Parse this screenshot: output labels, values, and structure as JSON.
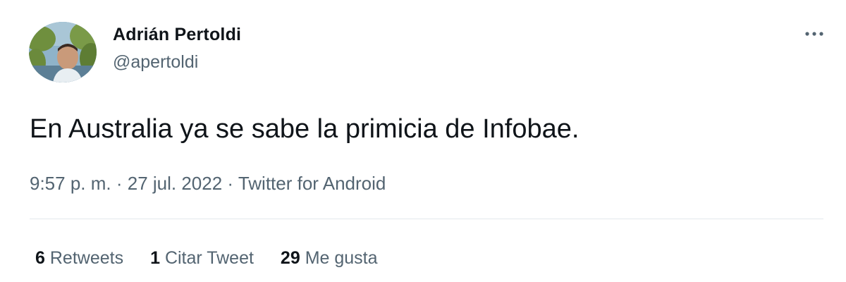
{
  "user": {
    "display_name": "Adrián Pertoldi",
    "handle": "@apertoldi",
    "avatar_icon": "profile-photo"
  },
  "tweet": {
    "text": "En Australia ya se sabe la primicia de Infobae.",
    "time": "9:57 p. m.",
    "sep1": " · ",
    "date": "27 jul. 2022",
    "sep2": " · ",
    "source": "Twitter for Android"
  },
  "stats": {
    "retweets_count": "6",
    "retweets_label": "Retweets",
    "quotes_count": "1",
    "quotes_label": "Citar Tweet",
    "likes_count": "29",
    "likes_label": "Me gusta"
  },
  "icons": {
    "more": "more-options-icon"
  },
  "colors": {
    "text_primary": "#0f1419",
    "text_secondary": "#536471",
    "divider": "#e3e8ec"
  }
}
